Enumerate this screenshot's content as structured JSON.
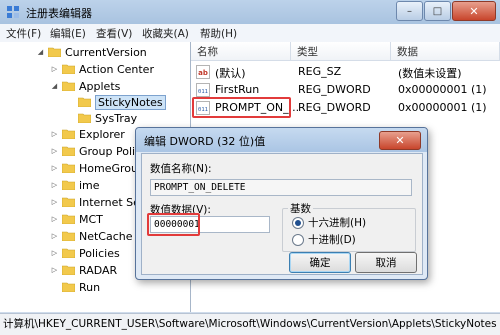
{
  "window": {
    "title": "注册表编辑器",
    "buttons": {
      "minimize": "–",
      "maximize": "□",
      "close": "✕"
    }
  },
  "menu": [
    "文件(F)",
    "编辑(E)",
    "查看(V)",
    "收藏夹(A)",
    "帮助(H)"
  ],
  "tree": [
    {
      "label": "CurrentVersion",
      "expander": "◢"
    },
    {
      "label": "Action Center",
      "expander": "▷"
    },
    {
      "label": "Applets",
      "expander": "◢"
    },
    {
      "label": "StickyNotes",
      "expander": "",
      "selected": true
    },
    {
      "label": "SysTray",
      "expander": ""
    },
    {
      "label": "Explorer",
      "expander": "▷"
    },
    {
      "label": "Group Polic",
      "expander": "▷"
    },
    {
      "label": "HomeGrou",
      "expander": "▷"
    },
    {
      "label": "ime",
      "expander": "▷"
    },
    {
      "label": "Internet Se",
      "expander": "▷"
    },
    {
      "label": "MCT",
      "expander": "▷"
    },
    {
      "label": "NetCache",
      "expander": "▷"
    },
    {
      "label": "Policies",
      "expander": "▷"
    },
    {
      "label": "RADAR",
      "expander": "▷"
    },
    {
      "label": "Run",
      "expander": ""
    }
  ],
  "values_pane": {
    "columns": {
      "name": "名称",
      "type": "类型",
      "data": "数据"
    },
    "rows": [
      {
        "icon": "string-value-icon",
        "icon_text": "ab",
        "name": "(默认)",
        "type": "REG_SZ",
        "data": "(数值未设置)"
      },
      {
        "icon": "binary-value-icon",
        "icon_text": "011",
        "name": "FirstRun",
        "type": "REG_DWORD",
        "data": "0x00000001 (1)"
      },
      {
        "icon": "binary-value-icon",
        "icon_text": "011",
        "name": "PROMPT_ON_...",
        "type": "REG_DWORD",
        "data": "0x00000001 (1)"
      }
    ]
  },
  "status_path": "计算机\\HKEY_CURRENT_USER\\Software\\Microsoft\\Windows\\CurrentVersion\\Applets\\StickyNotes",
  "dialog": {
    "title": "编辑 DWORD (32 位)值",
    "close": "✕",
    "value_name_label": "数值名称(N):",
    "value_name": "PROMPT_ON_DELETE",
    "value_data_label": "数值数据(V):",
    "value_data": "00000001",
    "base_label": "基数",
    "base_options": [
      {
        "label": "十六进制(H)",
        "checked": true
      },
      {
        "label": "十进制(D)",
        "checked": false
      }
    ],
    "ok": "确定",
    "cancel": "取消"
  },
  "colors": {
    "highlight": "#e23b3b",
    "folder": "#f2c94c",
    "selection": "#cde3f7"
  }
}
